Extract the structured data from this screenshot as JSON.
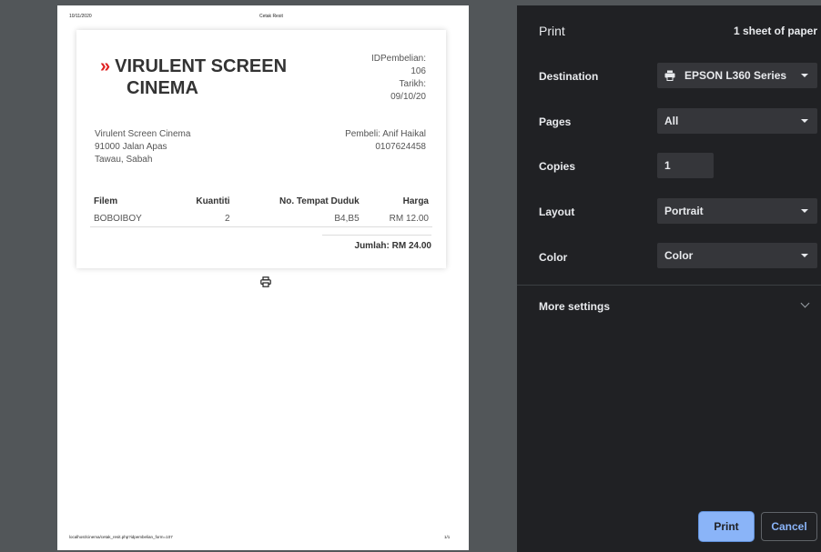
{
  "preview": {
    "header_date": "10/11/2020",
    "header_title": "Cetak Resit",
    "footer_url": "localhost/cinema/cetak_resit.php?idpembelian_form=107",
    "footer_page": "1/1",
    "receipt": {
      "logo_mark": "»",
      "logo_line1": "VIRULENT SCREEN",
      "logo_line2": "CINEMA",
      "id_label": "IDPembelian:",
      "id_value": "106",
      "date_label": "Tarikh:",
      "date_value": "09/10/20",
      "address_line1": "Virulent Screen Cinema",
      "address_line2": "91000 Jalan Apas",
      "address_line3": "Tawau, Sabah",
      "buyer": "Pembeli: Anif Haikal",
      "phone": "0107624458",
      "table_headers": [
        "Filem",
        "Kuantiti",
        "No. Tempat Duduk",
        "Harga"
      ],
      "rows": [
        {
          "filem": "BOBOIBOY",
          "kuantiti": "2",
          "tempat": "B4,B5",
          "harga": "RM 12.00"
        }
      ],
      "total": "Jumlah: RM 24.00"
    },
    "print_icon": "printer-icon"
  },
  "panel": {
    "title": "Print",
    "sheets": "1 sheet of paper",
    "destination_label": "Destination",
    "destination_value": "EPSON L360 Series",
    "destination_icon": "printer-icon",
    "pages_label": "Pages",
    "pages_value": "All",
    "copies_label": "Copies",
    "copies_value": "1",
    "layout_label": "Layout",
    "layout_value": "Portrait",
    "color_label": "Color",
    "color_value": "Color",
    "more_settings": "More settings",
    "print_button": "Print",
    "cancel_button": "Cancel"
  },
  "colors": {
    "accent": "#8ab4f8",
    "panel_bg": "#202124",
    "logo_red": "#e02020"
  }
}
